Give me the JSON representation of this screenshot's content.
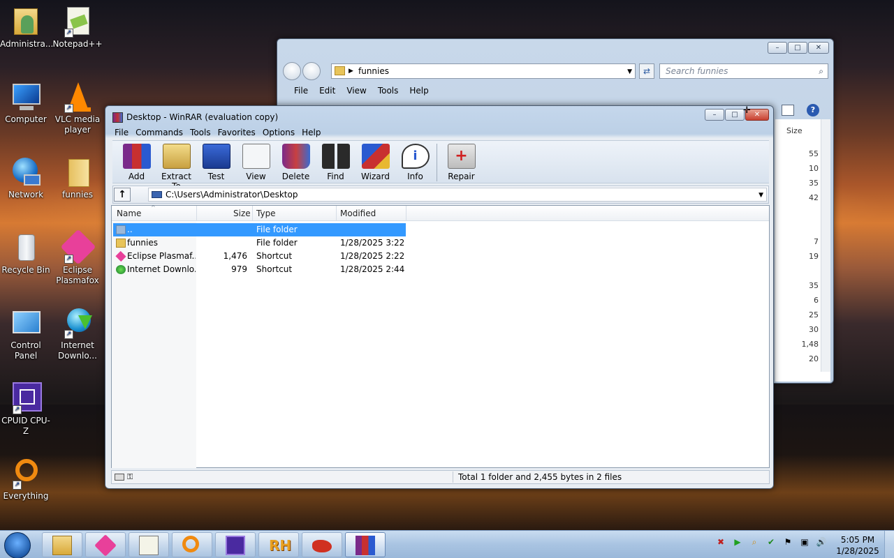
{
  "desktop": {
    "icons": [
      {
        "label": "Administra...",
        "icon": "user-folder-icon"
      },
      {
        "label": "Notepad++",
        "icon": "notepadpp-icon"
      },
      {
        "label": "Computer",
        "icon": "computer-icon"
      },
      {
        "label": "VLC media player",
        "icon": "vlc-icon"
      },
      {
        "label": "Network",
        "icon": "network-icon"
      },
      {
        "label": "funnies",
        "icon": "folder-icon"
      },
      {
        "label": "Recycle Bin",
        "icon": "recycle-bin-icon"
      },
      {
        "label": "Eclipse Plasmafox",
        "icon": "plasmafox-icon"
      },
      {
        "label": "Control Panel",
        "icon": "control-panel-icon"
      },
      {
        "label": "Internet Downlo...",
        "icon": "idm-icon"
      },
      {
        "label": "CPUID CPU-Z",
        "icon": "cpuz-icon"
      },
      {
        "label": "Everything",
        "icon": "everything-icon"
      }
    ]
  },
  "explorer": {
    "address": "funnies",
    "search_placeholder": "Search funnies",
    "menu": [
      "File",
      "Edit",
      "View",
      "Tools",
      "Help"
    ],
    "size_header": "Size",
    "sizes": [
      "55",
      "10",
      "35",
      "42",
      "7",
      "19",
      "35",
      "6",
      "25",
      "30",
      "1,48",
      "20"
    ]
  },
  "winrar": {
    "title": "Desktop - WinRAR (evaluation copy)",
    "menu": [
      "File",
      "Commands",
      "Tools",
      "Favorites",
      "Options",
      "Help"
    ],
    "toolbar": [
      {
        "label": "Add",
        "icon": "add-archive-icon"
      },
      {
        "label": "Extract To",
        "icon": "extract-icon"
      },
      {
        "label": "Test",
        "icon": "test-icon"
      },
      {
        "label": "View",
        "icon": "view-icon"
      },
      {
        "label": "Delete",
        "icon": "delete-icon"
      },
      {
        "label": "Find",
        "icon": "find-binoculars-icon"
      },
      {
        "label": "Wizard",
        "icon": "wizard-icon"
      },
      {
        "label": "Info",
        "icon": "info-icon"
      },
      {
        "label": "Repair",
        "icon": "repair-icon"
      }
    ],
    "path": "C:\\Users\\Administrator\\Desktop",
    "columns": [
      "Name",
      "Size",
      "Type",
      "Modified"
    ],
    "rows": [
      {
        "name": "..",
        "size": "",
        "type": "File folder",
        "modified": ""
      },
      {
        "name": "funnies",
        "size": "",
        "type": "File folder",
        "modified": "1/28/2025 3:22 ..."
      },
      {
        "name": "Eclipse Plasmaf...",
        "size": "1,476",
        "type": "Shortcut",
        "modified": "1/28/2025 2:22 ..."
      },
      {
        "name": "Internet Downlo...",
        "size": "979",
        "type": "Shortcut",
        "modified": "1/28/2025 2:44 ..."
      }
    ],
    "status": "Total 1 folder and 2,455 bytes in 2 files"
  },
  "taskbar": {
    "items": [
      "explorer",
      "plasmafox",
      "notepadpp",
      "search-tool",
      "cpuz",
      "rh",
      "app",
      "winrar"
    ],
    "time": "5:05 PM",
    "date": "1/28/2025"
  }
}
